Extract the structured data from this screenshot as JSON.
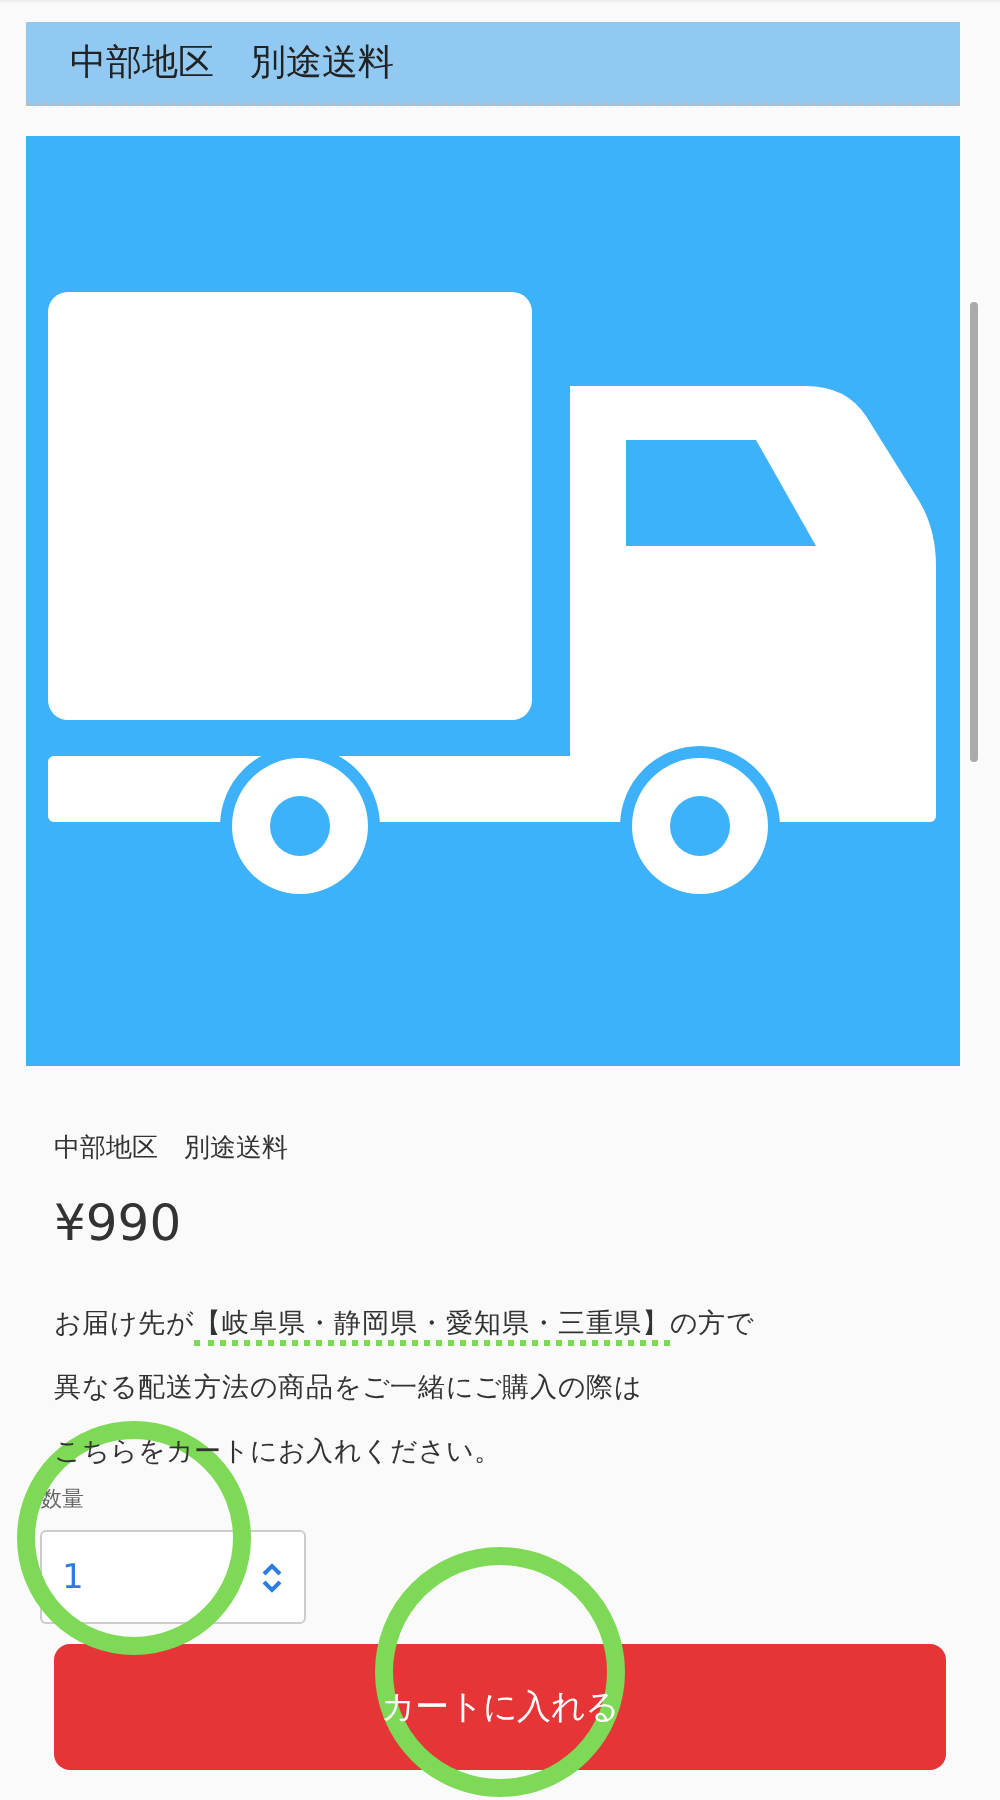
{
  "header": {
    "title": "中部地区　別途送料"
  },
  "product": {
    "title": "中部地区　別途送料",
    "price": "¥990"
  },
  "notice": {
    "lines": [
      {
        "before": "お届け先が",
        "highlight": "【岐阜県・静岡県・愛知県・三重県】",
        "after": "の方で"
      },
      {
        "before": "異なる配送方法の商品をご一緒にご購入の際は"
      },
      {
        "before": "こちらをカートにお入れください。"
      }
    ]
  },
  "quantity": {
    "label": "数量",
    "value": "1"
  },
  "cart_button": {
    "label": "カートに入れる"
  }
}
